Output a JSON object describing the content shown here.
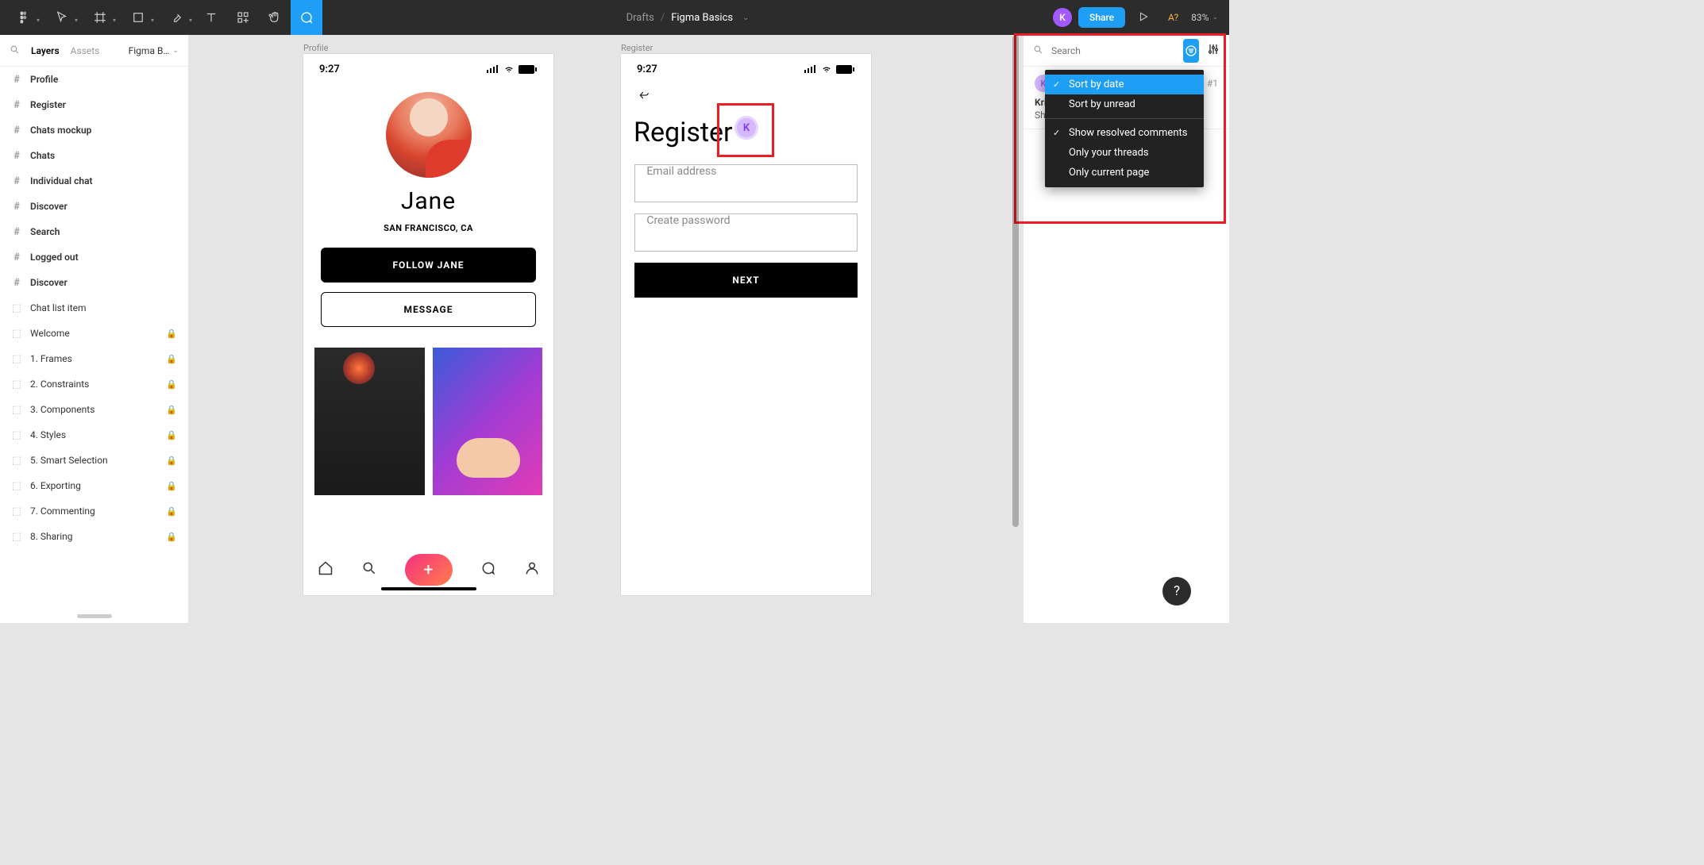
{
  "toolbar": {
    "breadcrumb_root": "Drafts",
    "breadcrumb_sep": "/",
    "file_name": "Figma Basics",
    "avatar_initial": "K",
    "share_label": "Share",
    "a_question": "A?",
    "zoom_label": "83%"
  },
  "left_panel": {
    "tab_layers": "Layers",
    "tab_assets": "Assets",
    "page_selector": "Figma B…",
    "rows": [
      {
        "icon": "hash",
        "label": "Profile",
        "bold": true,
        "locked": false
      },
      {
        "icon": "hash",
        "label": "Register",
        "bold": true,
        "locked": false
      },
      {
        "icon": "hash",
        "label": "Chats mockup",
        "bold": true,
        "locked": false
      },
      {
        "icon": "hash",
        "label": "Chats",
        "bold": true,
        "locked": false
      },
      {
        "icon": "hash",
        "label": "Individual chat",
        "bold": true,
        "locked": false
      },
      {
        "icon": "hash",
        "label": "Discover",
        "bold": true,
        "locked": false
      },
      {
        "icon": "hash",
        "label": "Search",
        "bold": true,
        "locked": false
      },
      {
        "icon": "hash",
        "label": "Logged out",
        "bold": true,
        "locked": false
      },
      {
        "icon": "hash",
        "label": "Discover",
        "bold": true,
        "locked": false
      },
      {
        "icon": "comp",
        "label": "Chat list item",
        "bold": false,
        "locked": false
      },
      {
        "icon": "comp",
        "label": "Welcome",
        "bold": false,
        "locked": true
      },
      {
        "icon": "comp",
        "label": "1. Frames",
        "bold": false,
        "locked": true
      },
      {
        "icon": "comp",
        "label": "2. Constraints",
        "bold": false,
        "locked": true
      },
      {
        "icon": "comp",
        "label": "3. Components",
        "bold": false,
        "locked": true
      },
      {
        "icon": "comp",
        "label": "4. Styles",
        "bold": false,
        "locked": true
      },
      {
        "icon": "comp",
        "label": "5. Smart Selection",
        "bold": false,
        "locked": true
      },
      {
        "icon": "comp",
        "label": "6. Exporting",
        "bold": false,
        "locked": true
      },
      {
        "icon": "comp",
        "label": "7. Commenting",
        "bold": false,
        "locked": true
      },
      {
        "icon": "comp",
        "label": "8. Sharing",
        "bold": false,
        "locked": true
      }
    ]
  },
  "canvas": {
    "frame_profile_label": "Profile",
    "frame_register_label": "Register",
    "status_time": "9:27",
    "profile_name": "Jane",
    "profile_location": "SAN FRANCISCO, CA",
    "follow_label": "FOLLOW JANE",
    "message_label": "MESSAGE",
    "register_title": "Register",
    "email_placeholder": "Email address",
    "password_placeholder": "Create password",
    "next_label": "NEXT",
    "cursor_initial": "K"
  },
  "right_panel": {
    "search_placeholder": "Search",
    "comment": {
      "avatar": "K",
      "number": "#1",
      "author": "Kris",
      "message": "Sho"
    },
    "dropdown": {
      "sort_date": "Sort by date",
      "sort_unread": "Sort by unread",
      "show_resolved": "Show resolved comments",
      "only_threads": "Only your threads",
      "only_page": "Only current page"
    }
  },
  "help_label": "?"
}
